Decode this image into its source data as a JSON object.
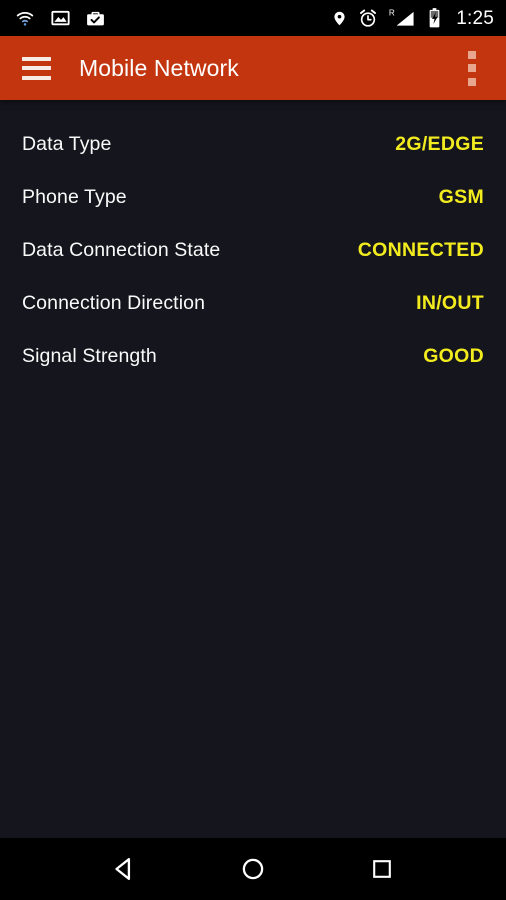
{
  "status_bar": {
    "time": "1:25",
    "left_icons": [
      {
        "name": "wifi-icon",
        "label": "Wi-Fi"
      },
      {
        "name": "image-icon",
        "label": "Screenshot / Image"
      },
      {
        "name": "work-profile-icon",
        "label": "Work profile"
      }
    ],
    "right_icons": [
      {
        "name": "location-pin-icon",
        "label": "Location"
      },
      {
        "name": "alarm-clock-icon",
        "label": "Alarm set"
      },
      {
        "name": "roaming-signal-icon",
        "label": "Roaming",
        "badge": "R"
      },
      {
        "name": "battery-charging-icon",
        "label": "Battery charging"
      }
    ]
  },
  "app_bar": {
    "menu_icon": "hamburger-icon",
    "title": "Mobile Network",
    "overflow_icon": "overflow-menu-icon",
    "background_color": "#c2350f"
  },
  "content": {
    "value_color": "#f2ec1e",
    "label_color": "#fafafa",
    "background_color": "#15151d",
    "rows": [
      {
        "label": "Data Type",
        "value": "2G/EDGE"
      },
      {
        "label": "Phone Type",
        "value": "GSM"
      },
      {
        "label": "Data Connection State",
        "value": "CONNECTED"
      },
      {
        "label": "Connection Direction",
        "value": "IN/OUT"
      },
      {
        "label": "Signal Strength",
        "value": "GOOD"
      }
    ]
  },
  "nav_bar": {
    "buttons": [
      {
        "name": "back-button",
        "label": "Back"
      },
      {
        "name": "home-button",
        "label": "Home"
      },
      {
        "name": "recents-button",
        "label": "Recent apps"
      }
    ]
  }
}
